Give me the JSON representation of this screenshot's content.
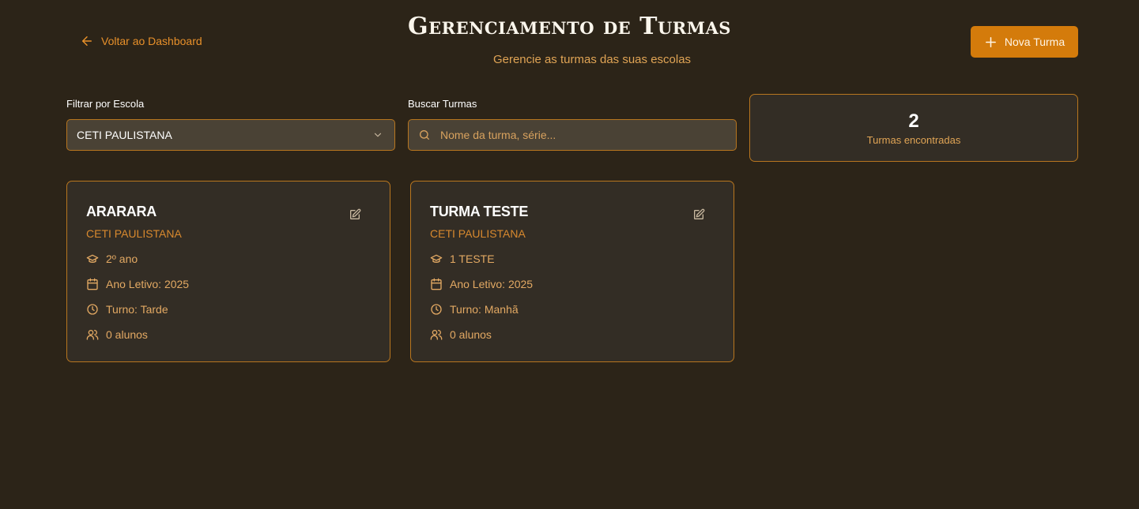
{
  "header": {
    "back_label": "Voltar ao Dashboard",
    "title": "Gerenciamento de Turmas",
    "subtitle": "Gerencie as turmas das suas escolas",
    "new_button_label": "Nova Turma"
  },
  "filters": {
    "school_label": "Filtrar por Escola",
    "school_value": "CETI PAULISTANA",
    "search_label": "Buscar Turmas",
    "search_placeholder": "Nome da turma, série...",
    "search_value": ""
  },
  "summary": {
    "count": "2",
    "label": "Turmas encontradas"
  },
  "classes": [
    {
      "name": "ARARARA",
      "school": "CETI PAULISTANA",
      "grade": "2º ano",
      "year": "Ano Letivo: 2025",
      "shift": "Turno: Tarde",
      "students": "0 alunos"
    },
    {
      "name": "TURMA TESTE",
      "school": "CETI PAULISTANA",
      "grade": "1 TESTE",
      "year": "Ano Letivo: 2025",
      "shift": "Turno: Manhã",
      "students": "0 alunos"
    }
  ],
  "icons": {
    "back": "arrow-left-icon",
    "new": "plus-icon",
    "select": "chevron-down-icon",
    "search": "search-icon",
    "edit": "edit-icon",
    "grade": "graduation-cap-icon",
    "year": "calendar-icon",
    "shift": "clock-icon",
    "students": "users-icon"
  },
  "colors": {
    "background": "#2c2418",
    "accent": "#d47b0b",
    "card": "#332d25",
    "border": "#b8761f"
  }
}
